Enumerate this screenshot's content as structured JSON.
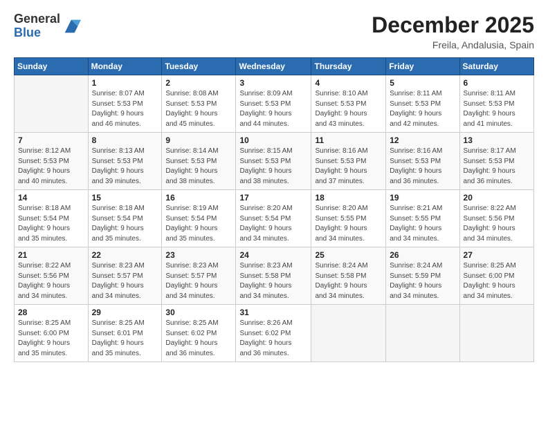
{
  "logo": {
    "general": "General",
    "blue": "Blue"
  },
  "title": "December 2025",
  "location": "Freila, Andalusia, Spain",
  "days_header": [
    "Sunday",
    "Monday",
    "Tuesday",
    "Wednesday",
    "Thursday",
    "Friday",
    "Saturday"
  ],
  "weeks": [
    [
      {
        "num": "",
        "info": ""
      },
      {
        "num": "1",
        "info": "Sunrise: 8:07 AM\nSunset: 5:53 PM\nDaylight: 9 hours\nand 46 minutes."
      },
      {
        "num": "2",
        "info": "Sunrise: 8:08 AM\nSunset: 5:53 PM\nDaylight: 9 hours\nand 45 minutes."
      },
      {
        "num": "3",
        "info": "Sunrise: 8:09 AM\nSunset: 5:53 PM\nDaylight: 9 hours\nand 44 minutes."
      },
      {
        "num": "4",
        "info": "Sunrise: 8:10 AM\nSunset: 5:53 PM\nDaylight: 9 hours\nand 43 minutes."
      },
      {
        "num": "5",
        "info": "Sunrise: 8:11 AM\nSunset: 5:53 PM\nDaylight: 9 hours\nand 42 minutes."
      },
      {
        "num": "6",
        "info": "Sunrise: 8:11 AM\nSunset: 5:53 PM\nDaylight: 9 hours\nand 41 minutes."
      }
    ],
    [
      {
        "num": "7",
        "info": "Sunrise: 8:12 AM\nSunset: 5:53 PM\nDaylight: 9 hours\nand 40 minutes."
      },
      {
        "num": "8",
        "info": "Sunrise: 8:13 AM\nSunset: 5:53 PM\nDaylight: 9 hours\nand 39 minutes."
      },
      {
        "num": "9",
        "info": "Sunrise: 8:14 AM\nSunset: 5:53 PM\nDaylight: 9 hours\nand 38 minutes."
      },
      {
        "num": "10",
        "info": "Sunrise: 8:15 AM\nSunset: 5:53 PM\nDaylight: 9 hours\nand 38 minutes."
      },
      {
        "num": "11",
        "info": "Sunrise: 8:16 AM\nSunset: 5:53 PM\nDaylight: 9 hours\nand 37 minutes."
      },
      {
        "num": "12",
        "info": "Sunrise: 8:16 AM\nSunset: 5:53 PM\nDaylight: 9 hours\nand 36 minutes."
      },
      {
        "num": "13",
        "info": "Sunrise: 8:17 AM\nSunset: 5:53 PM\nDaylight: 9 hours\nand 36 minutes."
      }
    ],
    [
      {
        "num": "14",
        "info": "Sunrise: 8:18 AM\nSunset: 5:54 PM\nDaylight: 9 hours\nand 35 minutes."
      },
      {
        "num": "15",
        "info": "Sunrise: 8:18 AM\nSunset: 5:54 PM\nDaylight: 9 hours\nand 35 minutes."
      },
      {
        "num": "16",
        "info": "Sunrise: 8:19 AM\nSunset: 5:54 PM\nDaylight: 9 hours\nand 35 minutes."
      },
      {
        "num": "17",
        "info": "Sunrise: 8:20 AM\nSunset: 5:54 PM\nDaylight: 9 hours\nand 34 minutes."
      },
      {
        "num": "18",
        "info": "Sunrise: 8:20 AM\nSunset: 5:55 PM\nDaylight: 9 hours\nand 34 minutes."
      },
      {
        "num": "19",
        "info": "Sunrise: 8:21 AM\nSunset: 5:55 PM\nDaylight: 9 hours\nand 34 minutes."
      },
      {
        "num": "20",
        "info": "Sunrise: 8:22 AM\nSunset: 5:56 PM\nDaylight: 9 hours\nand 34 minutes."
      }
    ],
    [
      {
        "num": "21",
        "info": "Sunrise: 8:22 AM\nSunset: 5:56 PM\nDaylight: 9 hours\nand 34 minutes."
      },
      {
        "num": "22",
        "info": "Sunrise: 8:23 AM\nSunset: 5:57 PM\nDaylight: 9 hours\nand 34 minutes."
      },
      {
        "num": "23",
        "info": "Sunrise: 8:23 AM\nSunset: 5:57 PM\nDaylight: 9 hours\nand 34 minutes."
      },
      {
        "num": "24",
        "info": "Sunrise: 8:23 AM\nSunset: 5:58 PM\nDaylight: 9 hours\nand 34 minutes."
      },
      {
        "num": "25",
        "info": "Sunrise: 8:24 AM\nSunset: 5:58 PM\nDaylight: 9 hours\nand 34 minutes."
      },
      {
        "num": "26",
        "info": "Sunrise: 8:24 AM\nSunset: 5:59 PM\nDaylight: 9 hours\nand 34 minutes."
      },
      {
        "num": "27",
        "info": "Sunrise: 8:25 AM\nSunset: 6:00 PM\nDaylight: 9 hours\nand 34 minutes."
      }
    ],
    [
      {
        "num": "28",
        "info": "Sunrise: 8:25 AM\nSunset: 6:00 PM\nDaylight: 9 hours\nand 35 minutes."
      },
      {
        "num": "29",
        "info": "Sunrise: 8:25 AM\nSunset: 6:01 PM\nDaylight: 9 hours\nand 35 minutes."
      },
      {
        "num": "30",
        "info": "Sunrise: 8:25 AM\nSunset: 6:02 PM\nDaylight: 9 hours\nand 36 minutes."
      },
      {
        "num": "31",
        "info": "Sunrise: 8:26 AM\nSunset: 6:02 PM\nDaylight: 9 hours\nand 36 minutes."
      },
      {
        "num": "",
        "info": ""
      },
      {
        "num": "",
        "info": ""
      },
      {
        "num": "",
        "info": ""
      }
    ]
  ]
}
